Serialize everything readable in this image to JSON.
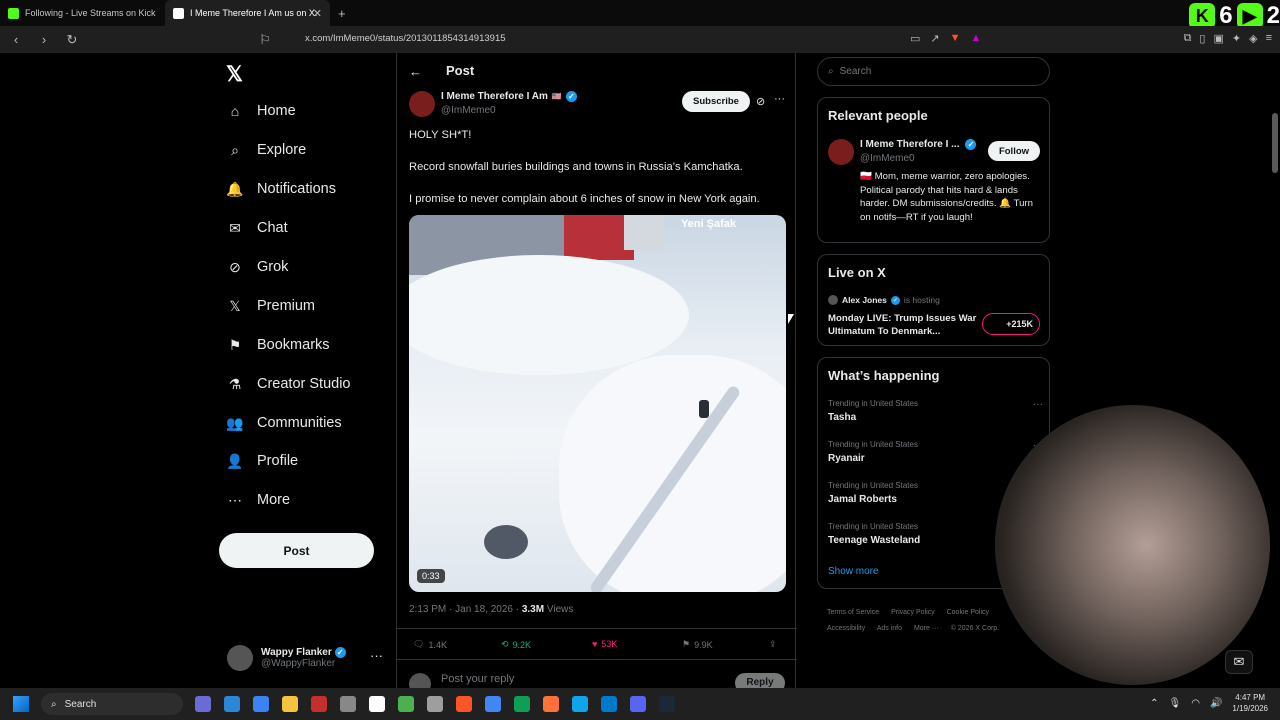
{
  "browser": {
    "tabs": [
      {
        "label": "Following - Live Streams on Kick",
        "color": "#53fc18"
      },
      {
        "label": "I Meme Therefore I Am us on X:",
        "color": "#ffffff"
      }
    ],
    "url": "x.com/ImMeme0/status/2013011854314913915",
    "kick_badges": [
      "6",
      "2"
    ]
  },
  "sidebar": {
    "logo": "𝕏",
    "items": [
      {
        "label": "Home",
        "icon": "⌂"
      },
      {
        "label": "Explore",
        "icon": "⌕"
      },
      {
        "label": "Notifications",
        "icon": "🔔"
      },
      {
        "label": "Chat",
        "icon": "✉"
      },
      {
        "label": "Grok",
        "icon": "⊘"
      },
      {
        "label": "Premium",
        "icon": "𝕏"
      },
      {
        "label": "Bookmarks",
        "icon": "⚑"
      },
      {
        "label": "Creator Studio",
        "icon": "⚗"
      },
      {
        "label": "Communities",
        "icon": "👥"
      },
      {
        "label": "Profile",
        "icon": "👤"
      },
      {
        "label": "More",
        "icon": "⋯"
      }
    ],
    "post_button": "Post",
    "account": {
      "name": "Wappy Flanker",
      "handle": "@WappyFlanker"
    }
  },
  "post": {
    "header_title": "Post",
    "author_name": "I Meme Therefore I Am",
    "author_flag": "🇺🇸",
    "author_handle": "@ImMeme0",
    "subscribe_label": "Subscribe",
    "lines": [
      "HOLY SH*T!",
      "Record snowfall buries buildings and towns in Russia’s Kamchatka.",
      "I promise to never complain about 6 inches of snow in New York again."
    ],
    "media_watermark": "Yeni Şafak",
    "video_duration": "0:33",
    "timestamp": "2:13 PM · Jan 18, 2026 · ",
    "views_count": "3.3M",
    "views_label": " Views",
    "replies": "1.4K",
    "reposts": "9.2K",
    "likes": "53K",
    "bookmarks": "9.9K",
    "reply_placeholder": "Post your reply",
    "reply_button": "Reply",
    "colors": {
      "repost": "#00ba7c",
      "like": "#f91880",
      "accent": "#1d9bf0"
    }
  },
  "right": {
    "search_placeholder": "Search",
    "relevant_title": "Relevant people",
    "relevant_name": "I Meme Therefore I ...",
    "relevant_handle": "@ImMeme0",
    "follow_label": "Follow",
    "relevant_bio": "🇵🇱 Mom, meme warrior, zero apologies. Political parody that hits hard & lands harder. DM submissions/credits. 🔔 Turn on notifs—RT if you laugh!",
    "live_title": "Live on X",
    "live_host": "Alex Jones",
    "live_hosting": "is hosting",
    "live_text": "Monday LIVE: Trump Issues War Ultimatum To Denmark...",
    "live_count": "+215K",
    "happening_title": "What’s happening",
    "trends": [
      {
        "context": "Trending in United States",
        "name": "Tasha"
      },
      {
        "context": "Trending in United States",
        "name": "Ryanair"
      },
      {
        "context": "Trending in United States",
        "name": "Jamal Roberts"
      },
      {
        "context": "Trending in United States",
        "name": "Teenage Wasteland"
      }
    ],
    "show_more": "Show more",
    "footer": [
      "Terms of Service",
      "Privacy Policy",
      "Cookie Policy",
      "Accessibility",
      "Ads info",
      "More ···",
      "© 2026 X Corp."
    ]
  },
  "taskbar": {
    "search_label": "Search",
    "time": "4:47 PM",
    "date": "1/19/2026"
  }
}
